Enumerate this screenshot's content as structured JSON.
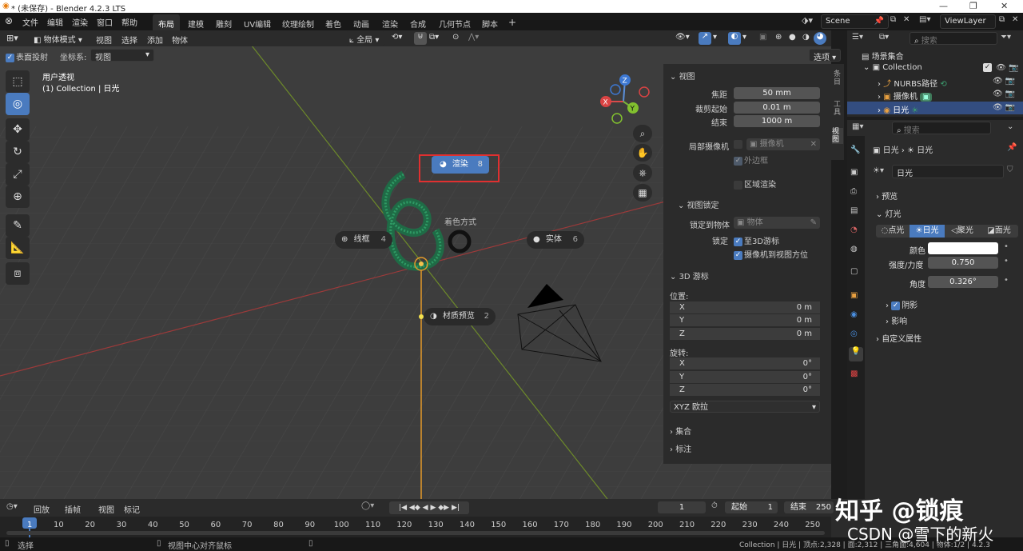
{
  "title": "* (未保存) - Blender 4.2.3 LTS",
  "menu": [
    "文件",
    "编辑",
    "渲染",
    "窗口",
    "帮助"
  ],
  "workspaces": [
    "布局",
    "建模",
    "雕刻",
    "UV编辑",
    "纹理绘制",
    "着色",
    "动画",
    "渲染",
    "合成",
    "几何节点",
    "脚本"
  ],
  "active_workspace": "布局",
  "add_tab": "+",
  "scene": "Scene",
  "view_layer": "ViewLayer",
  "viewport_header": {
    "mode": "物体模式",
    "menus": [
      "视图",
      "选择",
      "添加",
      "物体"
    ],
    "transform": "全局",
    "options": "选项"
  },
  "tool_settings": {
    "surface_project": "表面投射",
    "coord_label": "坐标系:",
    "coord_value": "视图"
  },
  "viewport_info": {
    "line1": "用户透视",
    "line2": "(1) Collection | 日光"
  },
  "gizmo": {
    "z": "Z",
    "x": "X",
    "y": "Y"
  },
  "pie_menu": {
    "title": "着色方式",
    "render": {
      "label": "渲染",
      "num": "8"
    },
    "wireframe": {
      "label": "线框",
      "num": "4"
    },
    "solid": {
      "label": "实体",
      "num": "6"
    },
    "material": {
      "label": "材质预览",
      "num": "2"
    }
  },
  "npanel": {
    "view_header": "视图",
    "focal_label": "焦距",
    "focal": "50 mm",
    "clip_start_label": "裁剪起始",
    "clip_start": "0.01 m",
    "clip_end_label": "结束",
    "clip_end": "1000 m",
    "local_cam_label": "局部摄像机",
    "local_cam_placeholder": "摄像机",
    "border_label": "外边框",
    "region_render_label": "区域渲染",
    "view_lock_header": "视图锁定",
    "lock_obj_label": "锁定到物体",
    "lock_obj_placeholder": "物体",
    "lock_label": "锁定",
    "lock_3d_cursor": "至3D游标",
    "lock_cam_view": "摄像机到视图方位",
    "cursor_header": "3D 游标",
    "location_label": "位置:",
    "loc": [
      {
        "axis": "X",
        "val": "0 m"
      },
      {
        "axis": "Y",
        "val": "0 m"
      },
      {
        "axis": "Z",
        "val": "0 m"
      }
    ],
    "rotation_label": "旋转:",
    "rot": [
      {
        "axis": "X",
        "val": "0°"
      },
      {
        "axis": "Y",
        "val": "0°"
      },
      {
        "axis": "Z",
        "val": "0°"
      }
    ],
    "rot_mode": "XYZ 欧拉",
    "collection_header": "集合",
    "annotation_header": "标注",
    "side_tabs": [
      "条目",
      "工具",
      "视图"
    ]
  },
  "outliner": {
    "search_placeholder": "搜索",
    "root": "场景集合",
    "collection": "Collection",
    "items": [
      "NURBS路径",
      "摄像机",
      "日光"
    ]
  },
  "properties": {
    "search_placeholder": "搜索",
    "breadcrumb_obj": "日光",
    "breadcrumb_data": "日光",
    "datablock": "日光",
    "preview": "预览",
    "light_header": "灯光",
    "light_types": [
      "点光",
      "日光",
      "聚光",
      "面光"
    ],
    "active_light_type": "日光",
    "color_label": "颜色",
    "color": "#ffffff",
    "strength_label": "强度/力度",
    "strength": "0.750",
    "angle_label": "角度",
    "angle": "0.326°",
    "shadow": "阴影",
    "influence": "影响",
    "custom_props": "自定义属性"
  },
  "timeline": {
    "menus": [
      "回放",
      "插帧",
      "视图",
      "标记"
    ],
    "current_frame": "1",
    "start_label": "起始",
    "start": "1",
    "end_label": "结束",
    "end": "250",
    "ruler": [
      "1",
      "10",
      "20",
      "30",
      "40",
      "50",
      "60",
      "70",
      "80",
      "90",
      "100",
      "110",
      "120",
      "130",
      "140",
      "150",
      "160",
      "170",
      "180",
      "190",
      "200",
      "210",
      "220",
      "230",
      "240",
      "250"
    ]
  },
  "status": {
    "select": "选择",
    "center_view": "视图中心对齐鼠标",
    "right": "Collection | 日光 | 顶点:2,328 | 面:2,312 | 三角面:4,604 | 物体:1/2 | 4.2.3"
  },
  "watermark": {
    "zhihu": "知乎 @锁痕",
    "csdn": "CSDN @雪下的新火"
  }
}
